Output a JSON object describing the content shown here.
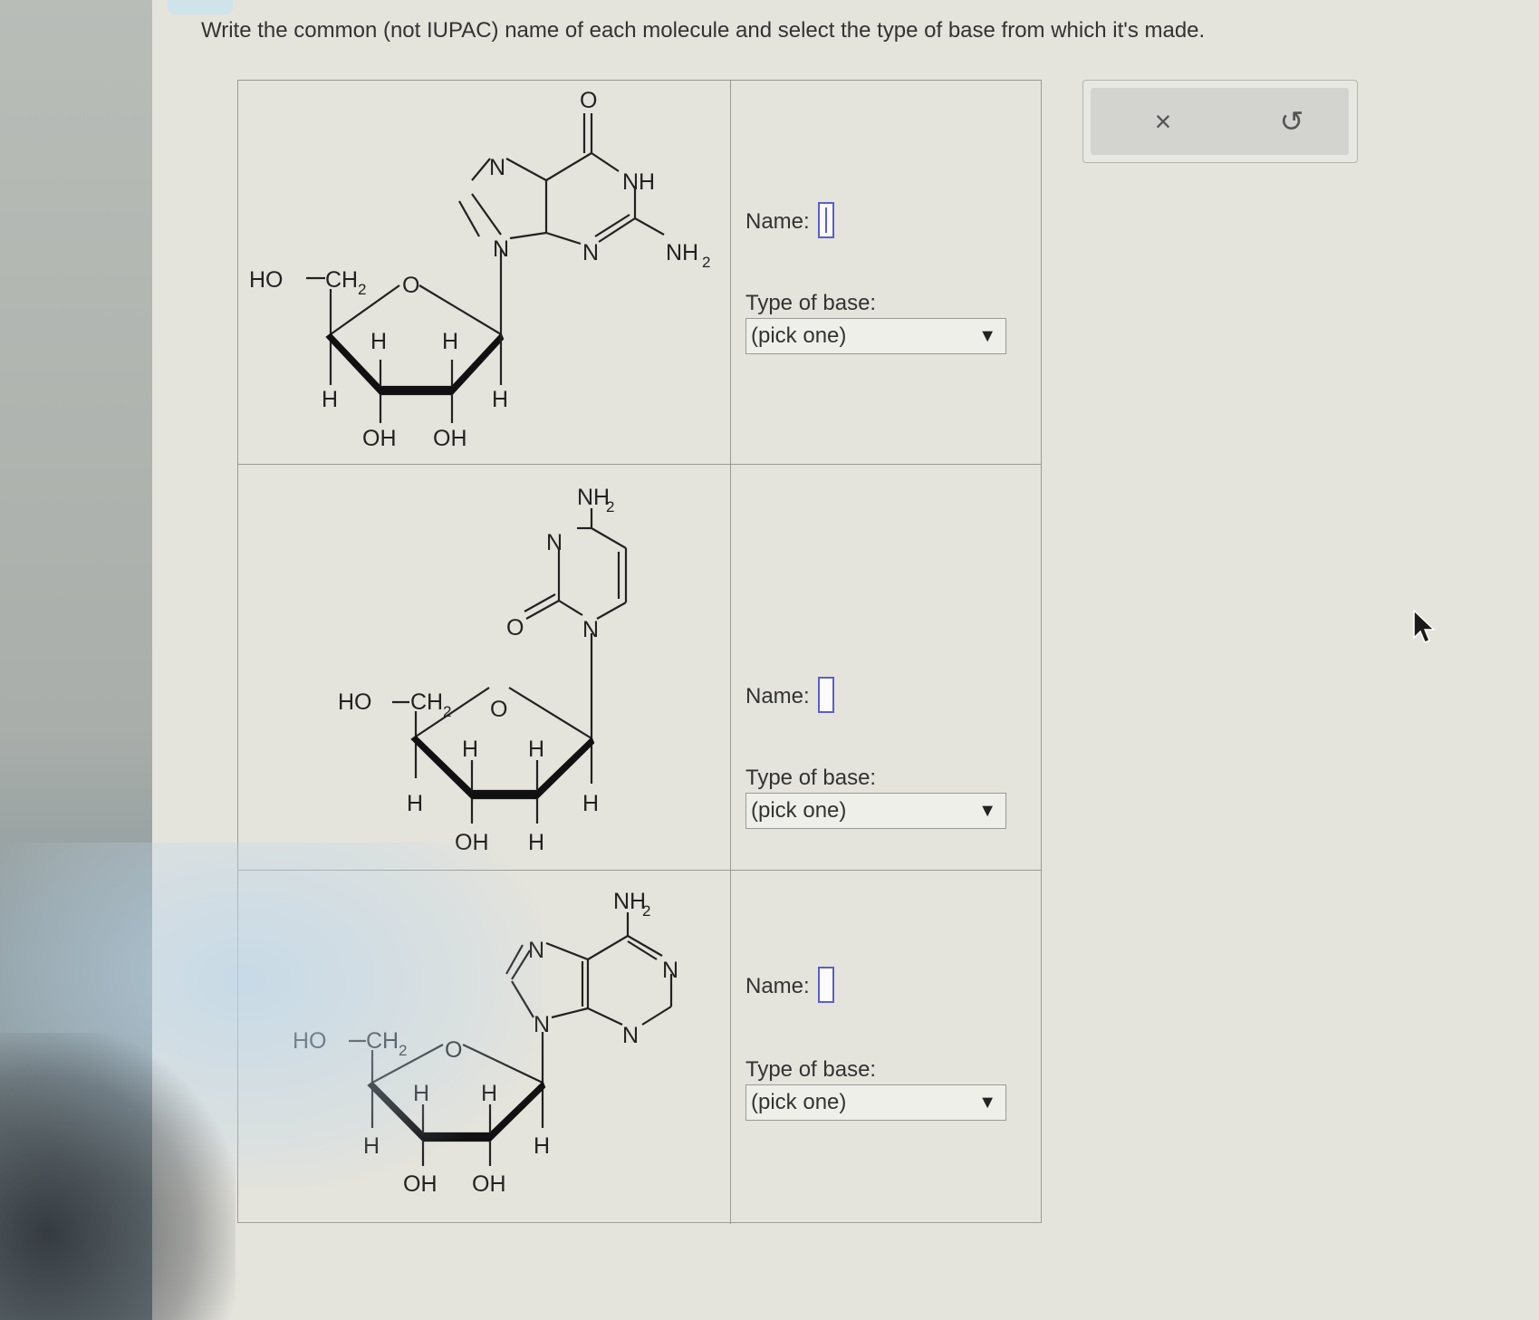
{
  "instruction": "Write the common (not IUPAC) name of each molecule and select the type of base from which it's made.",
  "rows": [
    {
      "molecule": {
        "labels": [
          "HO",
          "CH",
          "2",
          "O",
          "H",
          "H",
          "H",
          "H",
          "OH",
          "OH",
          "N",
          "N",
          "O",
          "NH",
          "N",
          "NH",
          "2"
        ]
      },
      "name_label": "Name:",
      "type_label": "Type of base:",
      "select_value": "(pick one)"
    },
    {
      "molecule": {
        "labels": [
          "NH",
          "2",
          "N",
          "O",
          "N",
          "HO",
          "CH",
          "2",
          "O",
          "H",
          "H",
          "H",
          "H",
          "OH",
          "H"
        ]
      },
      "name_label": "Name:",
      "type_label": "Type of base:",
      "select_value": "(pick one)"
    },
    {
      "molecule": {
        "labels": [
          "NH",
          "2",
          "N",
          "N",
          "N",
          "N",
          "HO",
          "CH",
          "2",
          "O",
          "H",
          "H",
          "H",
          "H",
          "OH",
          "OH"
        ]
      },
      "name_label": "Name:",
      "type_label": "Type of base:",
      "select_value": "(pick one)"
    }
  ],
  "toolbar": {
    "clear_icon": "×",
    "undo_icon": "↺"
  },
  "icons": {
    "dropdown": "▼",
    "clear": "close-icon",
    "undo": "undo-icon",
    "cursor": "mouse-pointer-icon"
  },
  "colors": {
    "input_border": "#5b5fc7",
    "background": "#e4e3dc"
  }
}
